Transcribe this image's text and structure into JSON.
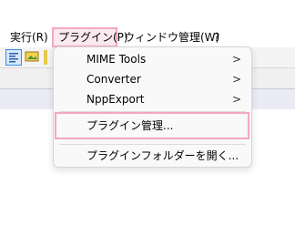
{
  "menubar": {
    "items": [
      {
        "label": "実行(R)"
      },
      {
        "label": "プラグイン(P)"
      },
      {
        "label": "ウィンドウ管理(W)"
      },
      {
        "label": "?"
      }
    ]
  },
  "toolbar": {
    "icons": [
      "align-icon",
      "image-icon",
      "x-mark-icon"
    ]
  },
  "plugins_menu": {
    "items": [
      {
        "label": "MIME Tools",
        "submenu_arrow": ">"
      },
      {
        "label": "Converter",
        "submenu_arrow": ">"
      },
      {
        "label": "NppExport",
        "submenu_arrow": ">"
      },
      {
        "label": "プラグイン管理..."
      },
      {
        "label": "プラグインフォルダーを開く..."
      }
    ]
  },
  "colors": {
    "highlight_border": "#f3a7c2",
    "selected_toolbar": "#3c8dde"
  }
}
